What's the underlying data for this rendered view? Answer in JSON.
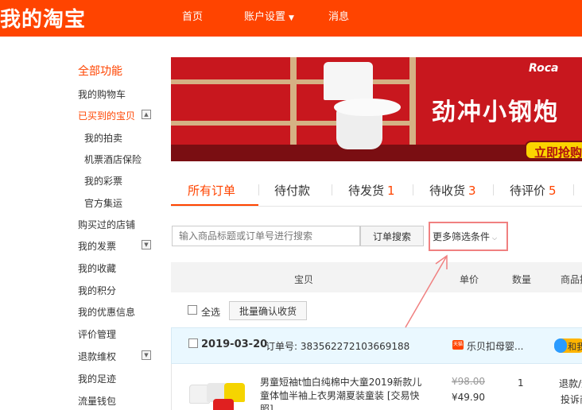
{
  "header": {
    "logo": "我的淘宝",
    "nav": {
      "home": "首页",
      "account": "账户设置",
      "messages": "消息"
    }
  },
  "sidebar": {
    "title": "全部功能",
    "items": [
      "我的购物车",
      "已买到的宝贝",
      "我的拍卖",
      "机票酒店保险",
      "我的彩票",
      "官方集运",
      "购买过的店铺",
      "我的发票",
      "我的收藏",
      "我的积分",
      "我的优惠信息",
      "评价管理",
      "退款维权",
      "我的足迹",
      "流量钱包"
    ]
  },
  "banner": {
    "brand": "Roca",
    "headline": "劲冲小钢炮 ",
    "cta": "立即抢购"
  },
  "tabs": [
    {
      "label": "所有订单",
      "count": ""
    },
    {
      "label": "待付款",
      "count": ""
    },
    {
      "label": "待发货",
      "count": "1"
    },
    {
      "label": "待收货",
      "count": "3"
    },
    {
      "label": "待评价",
      "count": "5"
    }
  ],
  "search": {
    "placeholder": "输入商品标题或订单号进行搜索",
    "button": "订单搜索",
    "more_filters": "更多筛选条件"
  },
  "table_header": {
    "item": "宝贝",
    "price": "单价",
    "qty": "数量",
    "ops": "商品操作"
  },
  "bulk": {
    "select_all": "全选",
    "batch_confirm": "批量确认收货"
  },
  "order": {
    "date": "2019-03-20",
    "order_no": "订单号: 383562272103669188",
    "shop": "乐贝扣母婴...",
    "contact": "和我联系",
    "item_title": "男童短袖t恤白纯棉中大童2019新款儿童体恤半袖上衣男潮夏装童装 [交易快照]",
    "price_old": "¥98.00",
    "price_now": "¥49.90",
    "qty": "1",
    "after_sale_1": "退款/退货",
    "after_sale_2": "投诉商家"
  },
  "colors": {
    "accent": "#ff4400",
    "banner": "#c8171e",
    "annotation": "#f08080"
  }
}
